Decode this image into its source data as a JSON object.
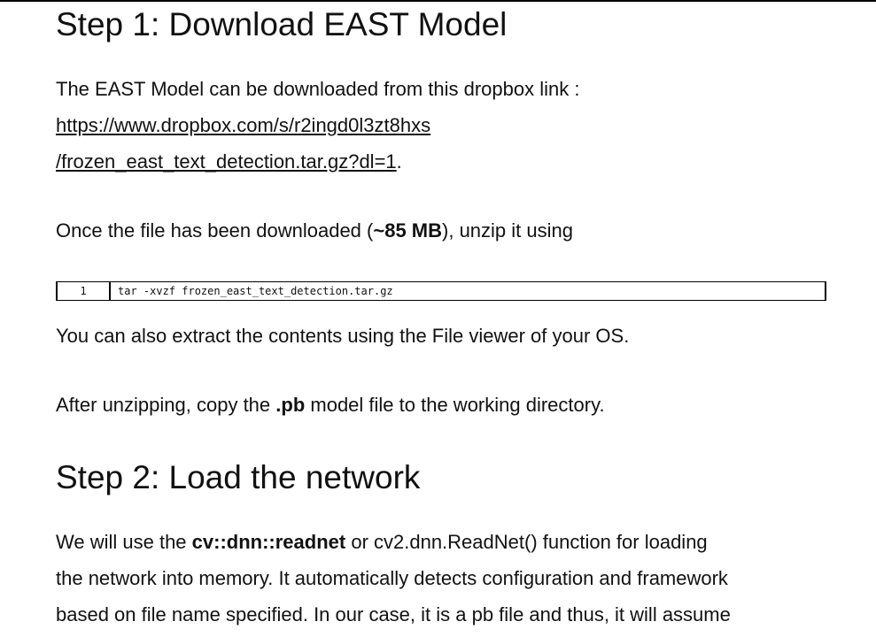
{
  "step1": {
    "heading": "Step 1: Download EAST Model",
    "intro": "The EAST Model can be downloaded from this dropbox link :",
    "link_line1": "https://www.dropbox.com/s/r2ingd0l3zt8hxs",
    "link_line2": "/frozen_east_text_detection.tar.gz?dl=1",
    "link_suffix": ".",
    "download_before": "Once the file has been downloaded (",
    "download_bold": "~85 MB",
    "download_after": "), unzip it using",
    "code": {
      "line_number": "1",
      "command": "tar -xvzf frozen_east_text_detection.tar.gz"
    },
    "extract_note": "You can also extract the contents using the File viewer of your OS.",
    "copy_before": "After unzipping, copy the ",
    "copy_bold": ".pb",
    "copy_after": " model file to the working directory."
  },
  "step2": {
    "heading": "Step 2: Load the network",
    "line1_before": "We will use the ",
    "line1_bold": "cv::dnn::readnet",
    "line1_after": " or cv2.dnn.ReadNet() function for loading",
    "line2": "the network into memory. It automatically detects configuration and framework",
    "line3": "based on file name specified. In our case, it is a pb file and thus, it will assume"
  }
}
